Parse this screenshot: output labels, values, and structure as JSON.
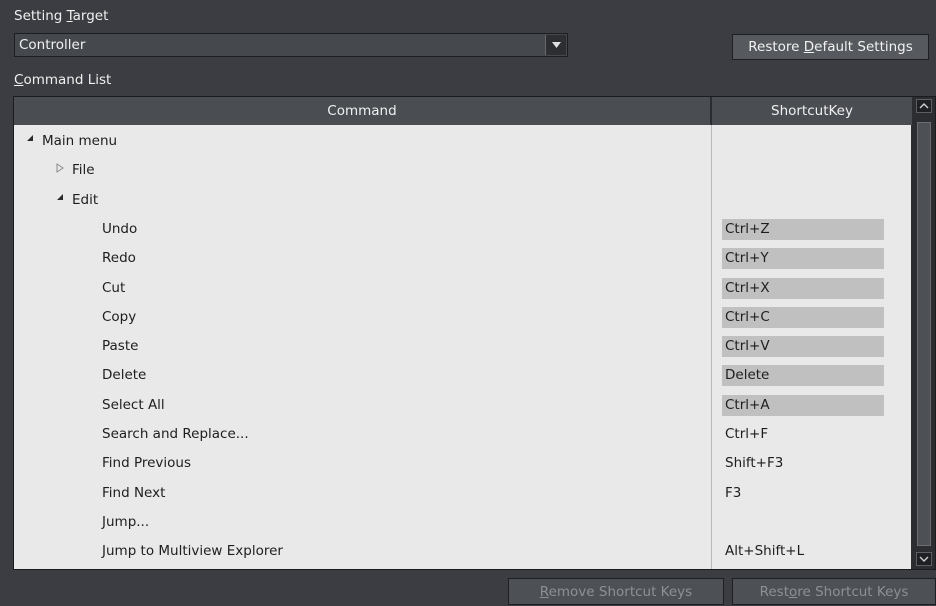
{
  "setting_target": {
    "label_prefix": "Setting ",
    "label_accel": "T",
    "label_suffix": "arget",
    "selected": "Controller"
  },
  "restore_default": {
    "prefix": "Restore ",
    "accel": "D",
    "suffix": "efault Settings"
  },
  "command_list": {
    "accel": "C",
    "suffix": "ommand List"
  },
  "grid": {
    "columns": [
      "Command",
      "ShortcutKey"
    ],
    "rows": [
      {
        "name": "Main menu",
        "level": 0,
        "expander": "expanded",
        "key": "",
        "highlight": false
      },
      {
        "name": "File",
        "level": 1,
        "expander": "collapsed",
        "key": "",
        "highlight": false
      },
      {
        "name": "Edit",
        "level": 1,
        "expander": "expanded",
        "key": "",
        "highlight": false
      },
      {
        "name": "Undo",
        "level": 2,
        "expander": "",
        "key": "Ctrl+Z",
        "highlight": true
      },
      {
        "name": "Redo",
        "level": 2,
        "expander": "",
        "key": "Ctrl+Y",
        "highlight": true
      },
      {
        "name": "Cut",
        "level": 2,
        "expander": "",
        "key": "Ctrl+X",
        "highlight": true
      },
      {
        "name": "Copy",
        "level": 2,
        "expander": "",
        "key": "Ctrl+C",
        "highlight": true
      },
      {
        "name": "Paste",
        "level": 2,
        "expander": "",
        "key": "Ctrl+V",
        "highlight": true
      },
      {
        "name": "Delete",
        "level": 2,
        "expander": "",
        "key": "Delete",
        "highlight": true
      },
      {
        "name": "Select All",
        "level": 2,
        "expander": "",
        "key": "Ctrl+A",
        "highlight": true
      },
      {
        "name": "Search and Replace...",
        "level": 2,
        "expander": "",
        "key": "Ctrl+F",
        "highlight": false
      },
      {
        "name": "Find Previous",
        "level": 2,
        "expander": "",
        "key": "Shift+F3",
        "highlight": false
      },
      {
        "name": "Find Next",
        "level": 2,
        "expander": "",
        "key": "F3",
        "highlight": false
      },
      {
        "name": "Jump...",
        "level": 2,
        "expander": "",
        "key": "",
        "highlight": false
      },
      {
        "name": "Jump to Multiview Explorer",
        "level": 2,
        "expander": "",
        "key": "Alt+Shift+L",
        "highlight": false
      }
    ]
  },
  "remove_keys": {
    "accel": "R",
    "suffix": "emove Shortcut Keys"
  },
  "restore_keys": {
    "prefix": "Rest",
    "accel": "o",
    "suffix": "re Shortcut Keys"
  },
  "icons": {
    "dropdown": "dropdown-arrow-icon",
    "expanded": "triangle-expanded-icon",
    "collapsed": "triangle-collapsed-icon",
    "scroll_up": "scroll-up-icon",
    "scroll_down": "scroll-down-icon"
  }
}
